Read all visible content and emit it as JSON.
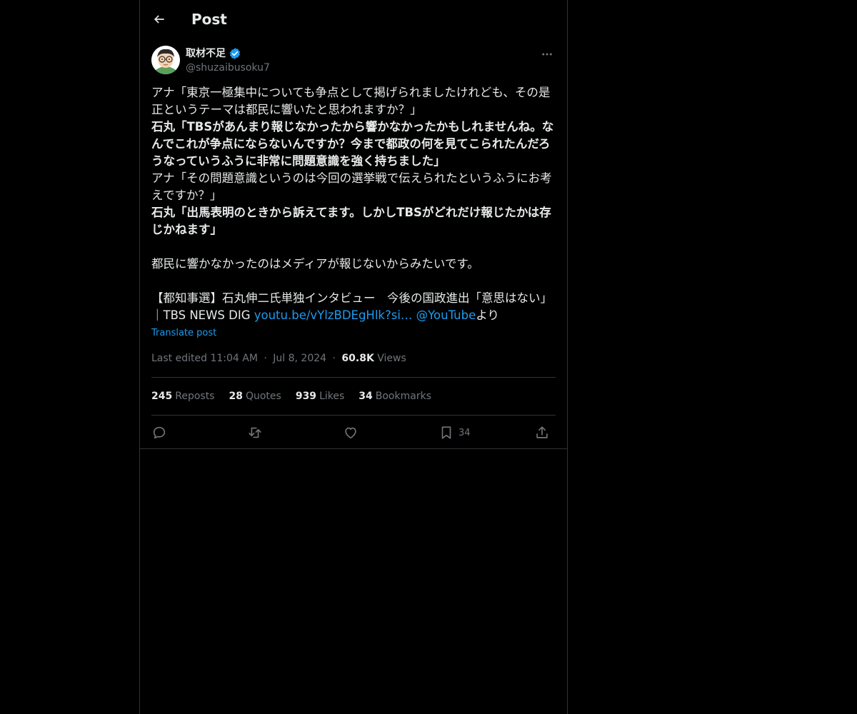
{
  "header": {
    "title": "Post"
  },
  "author": {
    "name": "取材不足",
    "handle": "@shuzaibusoku7"
  },
  "tweet": {
    "lines": [
      {
        "text": "アナ「東京一極集中についても争点として掲げられましたけれども、その是正というテーマは都民に響いたと思われますか？」",
        "bold": false
      },
      {
        "text": "石丸「TBSがあんまり報じなかったから響かなかったかもしれませんね。なんでこれが争点にならないんですか？今まで都政の何を見てこられたんだろうなっていうふうに非常に問題意識を強く持ちました」",
        "bold": true
      },
      {
        "text": "アナ「その問題意識というのは今回の選挙戦で伝えられたというふうにお考えですか？」",
        "bold": false
      },
      {
        "text": "石丸「出馬表明のときから訴えてます。しかしTBSがどれだけ報じたかは存じかねます」",
        "bold": true
      },
      {
        "text": "都民に響かなかったのはメディアが報じないからみたいです。",
        "bold": false
      }
    ],
    "source_text": "【都知事選】石丸伸二氏単独インタビュー　今後の国政進出「意思はない」｜TBS NEWS DIG ",
    "source_link": "youtu.be/vYlzBDEgHlk?si…",
    "source_mention": "@YouTube",
    "source_suffix": "より",
    "translate": "Translate post"
  },
  "meta": {
    "edited": "Last edited 11:04 AM",
    "date": "Jul 8, 2024",
    "views_count": "60.8K",
    "views_label": "Views",
    "dot": "·"
  },
  "stats": [
    {
      "count": "245",
      "label": "Reposts"
    },
    {
      "count": "28",
      "label": "Quotes"
    },
    {
      "count": "939",
      "label": "Likes"
    },
    {
      "count": "34",
      "label": "Bookmarks"
    }
  ],
  "actions": {
    "reply_icon": "reply-icon",
    "repost_icon": "repost-icon",
    "like_icon": "heart-icon",
    "bookmark_icon": "bookmark-icon",
    "bookmark_count": "34",
    "share_icon": "share-icon"
  },
  "colors": {
    "accent": "#1d9bf0",
    "text": "#e7e9ea",
    "muted": "#71767b",
    "border": "#2f3336"
  }
}
